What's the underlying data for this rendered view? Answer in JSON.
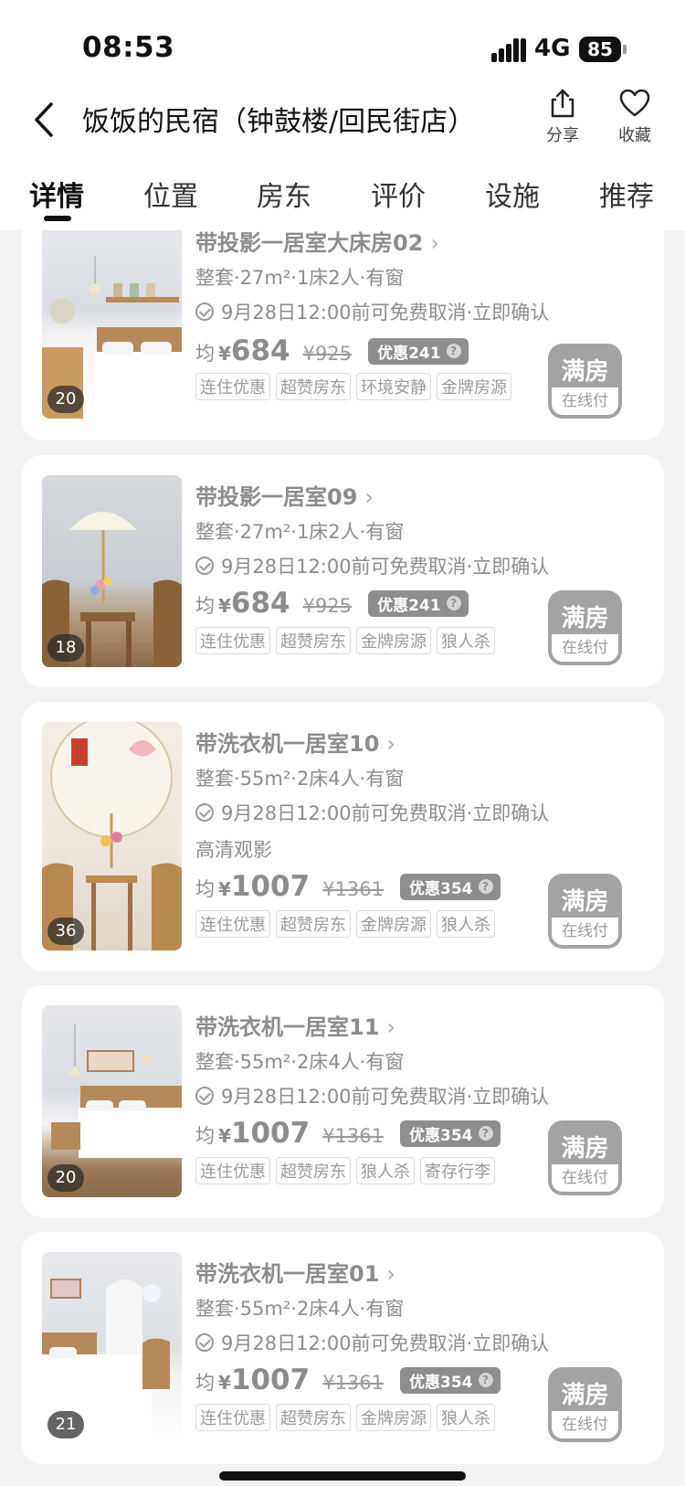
{
  "status_bar": {
    "time": "08:53",
    "network": "4G",
    "battery": "85"
  },
  "header": {
    "title": "饭饭的民宿（钟鼓楼/回民街店）",
    "share_label": "分享",
    "favorite_label": "收藏"
  },
  "tabs": [
    {
      "label": "详情",
      "active": true
    },
    {
      "label": "位置",
      "active": false
    },
    {
      "label": "房东",
      "active": false
    },
    {
      "label": "评价",
      "active": false
    },
    {
      "label": "设施",
      "active": false
    },
    {
      "label": "推荐",
      "active": false
    }
  ],
  "rooms": [
    {
      "name": "带投影一居室大床房02",
      "photo_count": "20",
      "specs": "整套·27m²·1床2人·有窗",
      "cancel": "9月28日12:00前可免费取消·立即确认",
      "extra": "",
      "avg_label": "均",
      "currency": "¥",
      "price": "684",
      "original_price": "¥925",
      "discount": "优惠241",
      "tags": [
        "连住优惠",
        "超赞房东",
        "环境安静",
        "金牌房源"
      ],
      "status": "满房",
      "status_sub": "在线付"
    },
    {
      "name": "带投影一居室09",
      "photo_count": "18",
      "specs": "整套·27m²·1床2人·有窗",
      "cancel": "9月28日12:00前可免费取消·立即确认",
      "extra": "",
      "avg_label": "均",
      "currency": "¥",
      "price": "684",
      "original_price": "¥925",
      "discount": "优惠241",
      "tags": [
        "连住优惠",
        "超赞房东",
        "金牌房源",
        "狼人杀"
      ],
      "status": "满房",
      "status_sub": "在线付"
    },
    {
      "name": "带洗衣机一居室10",
      "photo_count": "36",
      "specs": "整套·55m²·2床4人·有窗",
      "cancel": "9月28日12:00前可免费取消·立即确认",
      "extra": "高清观影",
      "avg_label": "均",
      "currency": "¥",
      "price": "1007",
      "original_price": "¥1361",
      "discount": "优惠354",
      "tags": [
        "连住优惠",
        "超赞房东",
        "金牌房源",
        "狼人杀"
      ],
      "status": "满房",
      "status_sub": "在线付"
    },
    {
      "name": "带洗衣机一居室11",
      "photo_count": "20",
      "specs": "整套·55m²·2床4人·有窗",
      "cancel": "9月28日12:00前可免费取消·立即确认",
      "extra": "",
      "avg_label": "均",
      "currency": "¥",
      "price": "1007",
      "original_price": "¥1361",
      "discount": "优惠354",
      "tags": [
        "连住优惠",
        "超赞房东",
        "狼人杀",
        "寄存行李"
      ],
      "status": "满房",
      "status_sub": "在线付"
    },
    {
      "name": "带洗衣机一居室01",
      "photo_count": "21",
      "specs": "整套·55m²·2床4人·有窗",
      "cancel": "9月28日12:00前可免费取消·立即确认",
      "extra": "",
      "avg_label": "均",
      "currency": "¥",
      "price": "1007",
      "original_price": "¥1361",
      "discount": "优惠354",
      "tags": [
        "连住优惠",
        "超赞房东",
        "金牌房源",
        "狼人杀"
      ],
      "status": "满房",
      "status_sub": "在线付"
    }
  ]
}
